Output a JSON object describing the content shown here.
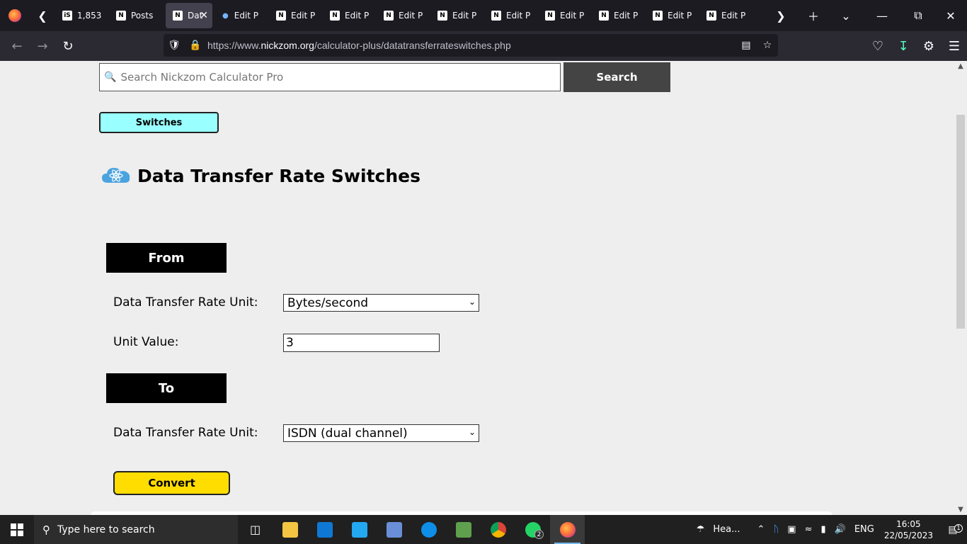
{
  "browser": {
    "tabs": [
      {
        "label": "1,853,",
        "icon": "is-favicon"
      },
      {
        "label": "Posts",
        "icon": "wp-favicon"
      },
      {
        "label": "Dat",
        "icon": "wp-favicon",
        "active": true
      },
      {
        "label": "Edit P",
        "icon": "wp-favicon",
        "unread": true
      },
      {
        "label": "Edit P",
        "icon": "wp-favicon"
      },
      {
        "label": "Edit P",
        "icon": "wp-favicon"
      },
      {
        "label": "Edit P",
        "icon": "wp-favicon"
      },
      {
        "label": "Edit P",
        "icon": "wp-favicon"
      },
      {
        "label": "Edit P",
        "icon": "wp-favicon"
      },
      {
        "label": "Edit P",
        "icon": "wp-favicon"
      },
      {
        "label": "Edit P",
        "icon": "wp-favicon"
      },
      {
        "label": "Edit P",
        "icon": "wp-favicon"
      },
      {
        "label": "Edit P",
        "icon": "wp-favicon"
      }
    ],
    "url_prefix": "https://www.",
    "url_domain": "nickzom.org",
    "url_path": "/calculator-plus/datatransferrateswitches.php"
  },
  "page": {
    "search_placeholder": "Search Nickzom Calculator Pro",
    "search_button": "Search",
    "switches_button": "Switches",
    "title": "Data Transfer Rate Switches",
    "from_header": "From",
    "from_unit_label": "Data Transfer Rate Unit:",
    "from_unit_value": "Bytes/second",
    "unit_value_label": "Unit Value:",
    "unit_value": "3",
    "to_header": "To",
    "to_unit_label": "Data Transfer Rate Unit:",
    "to_unit_value": "ISDN (dual channel)",
    "convert_button": "Convert"
  },
  "taskbar": {
    "search_placeholder": "Type here to search",
    "weather_label": "Hea...",
    "language": "ENG",
    "time": "16:05",
    "date": "22/05/2023",
    "whatsapp_badge": "2",
    "notification_count": "1"
  }
}
